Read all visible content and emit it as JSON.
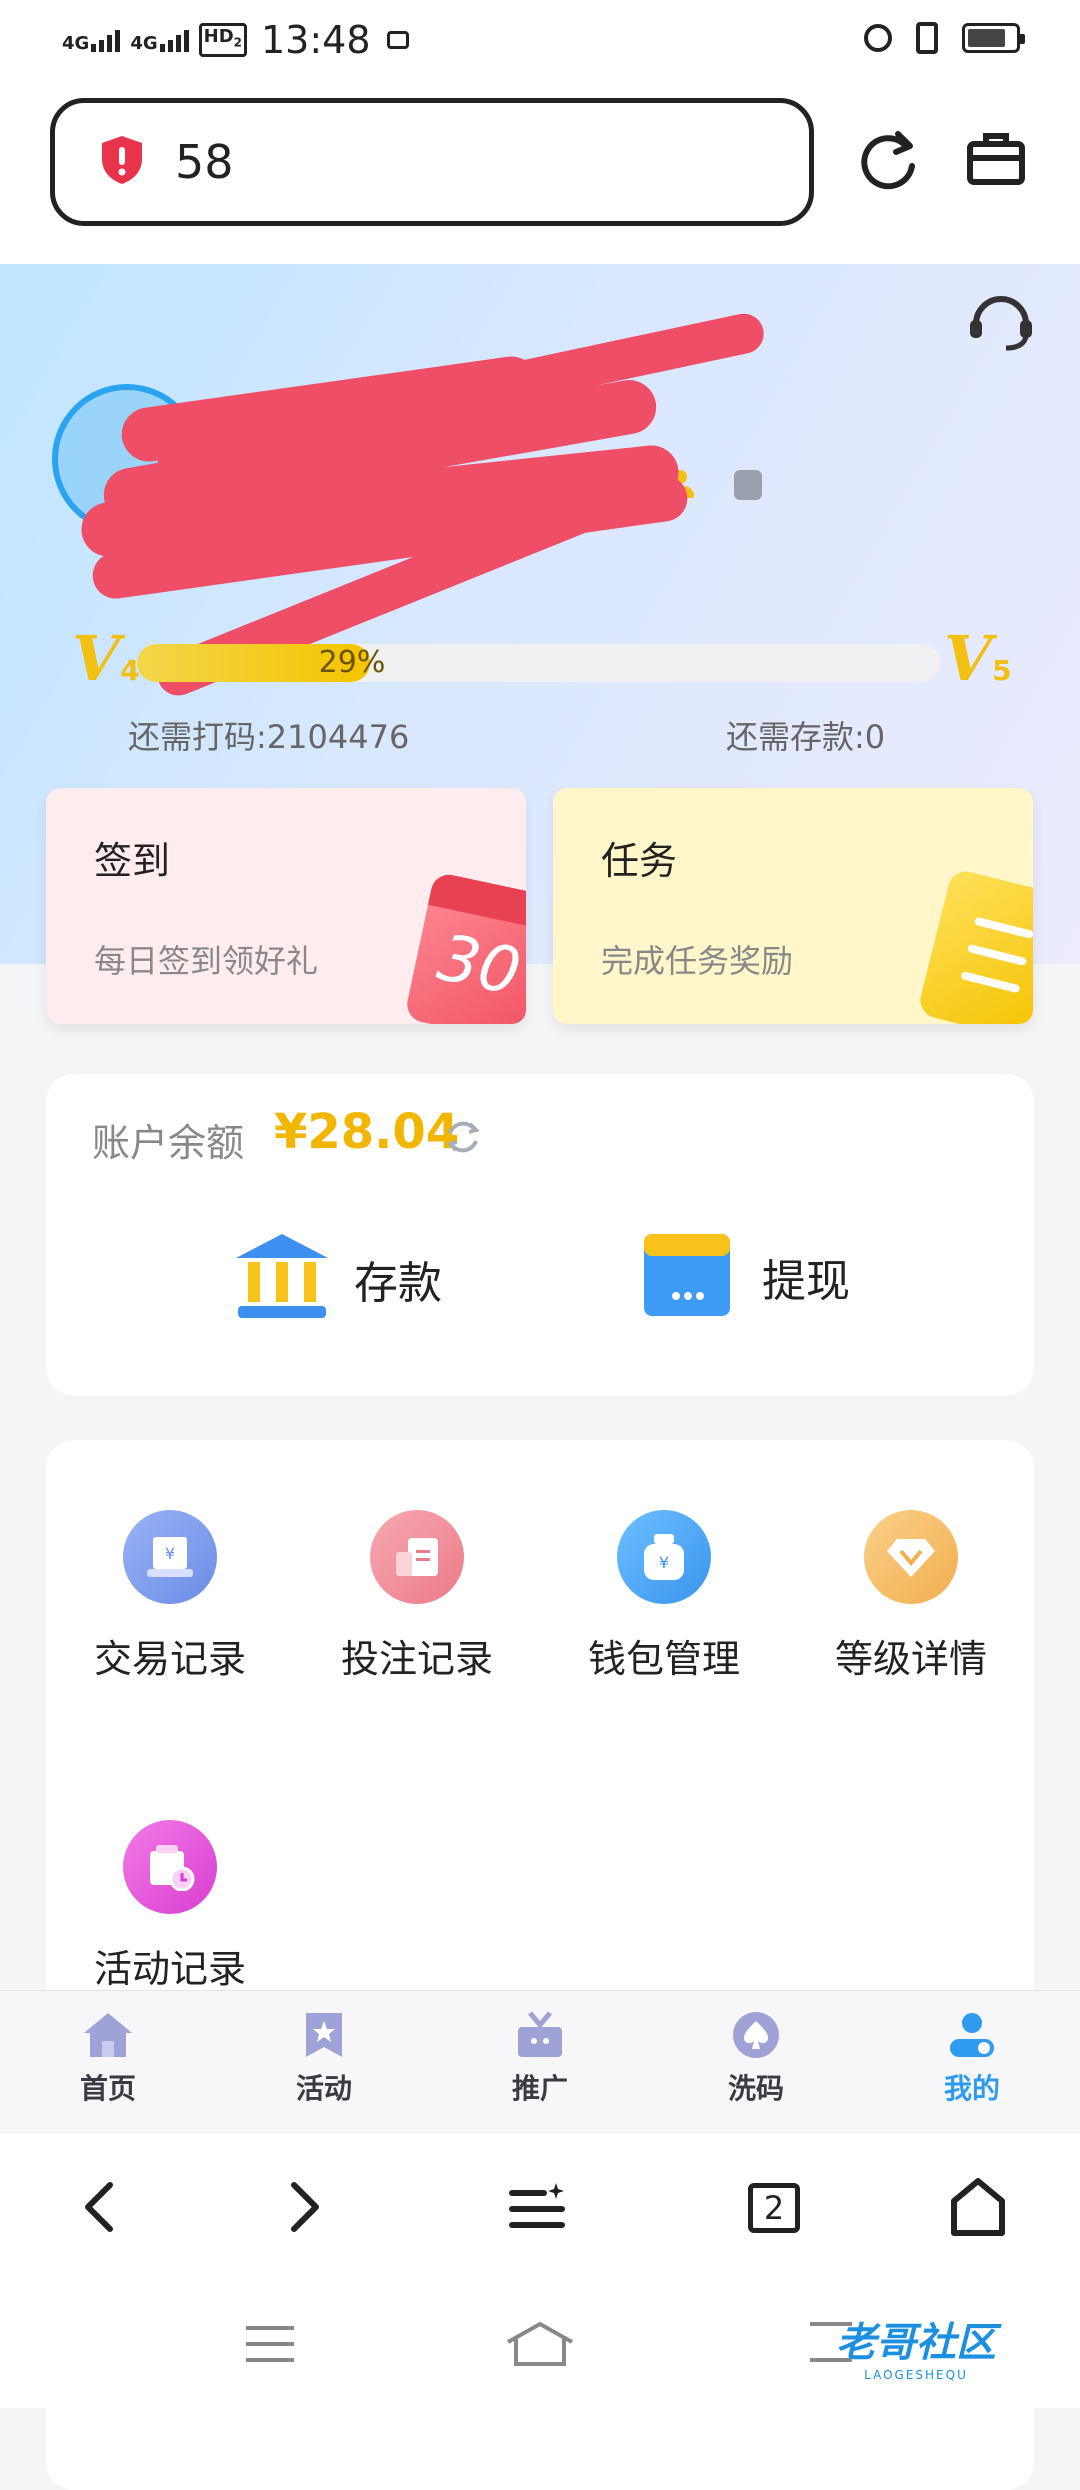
{
  "status_bar": {
    "network_1": "4G",
    "network_2": "4G",
    "hd_badge": "HD",
    "hd_sub": "2",
    "time": "13:48",
    "battery_percent": 80
  },
  "url_bar": {
    "text": "58",
    "icons": [
      "shield-alert-icon",
      "refresh-icon",
      "toolbox-icon"
    ]
  },
  "profile": {
    "support_icon": "headset-icon",
    "level_current": "V",
    "level_current_num": "4",
    "level_next": "V",
    "level_next_num": "5",
    "progress_label": "29%",
    "progress_value": 0.29,
    "need_wager": "还需打码:2104476",
    "need_deposit": "还需存款:0"
  },
  "cards": {
    "checkin": {
      "title": "签到",
      "subtitle": "每日签到领好礼",
      "badge": "30",
      "bg": "#ffecef"
    },
    "tasks": {
      "title": "任务",
      "subtitle": "完成任务奖励",
      "bg": "#fff6c9"
    }
  },
  "balance": {
    "label": "账户余额",
    "amount": "¥28.04",
    "accent": "#f2b500",
    "deposit_label": "存款",
    "withdraw_label": "提现"
  },
  "features": [
    {
      "label": "交易记录",
      "icon": "transaction-record-icon",
      "color": "#7b9cf0"
    },
    {
      "label": "投注记录",
      "icon": "bet-record-icon",
      "color": "#f08c98"
    },
    {
      "label": "钱包管理",
      "icon": "wallet-icon",
      "color": "#4aa3f2"
    },
    {
      "label": "等级详情",
      "icon": "diamond-icon",
      "color": "#f5c06a"
    },
    {
      "label": "活动记录",
      "icon": "activity-record-icon",
      "color": "#e85ad8"
    }
  ],
  "tabbar": [
    {
      "label": "首页",
      "icon": "home-icon",
      "active": false
    },
    {
      "label": "活动",
      "icon": "star-bookmark-icon",
      "active": false
    },
    {
      "label": "推广",
      "icon": "gift-icon",
      "active": false
    },
    {
      "label": "洗码",
      "icon": "spade-coin-icon",
      "active": false
    },
    {
      "label": "我的",
      "icon": "user-toggle-icon",
      "active": true
    }
  ],
  "tab_active_color": "#2f9bf0",
  "browser_nav": {
    "tab_count": "2"
  },
  "watermark": {
    "text": "老哥社区",
    "sub": "LAOGESHEQU"
  }
}
